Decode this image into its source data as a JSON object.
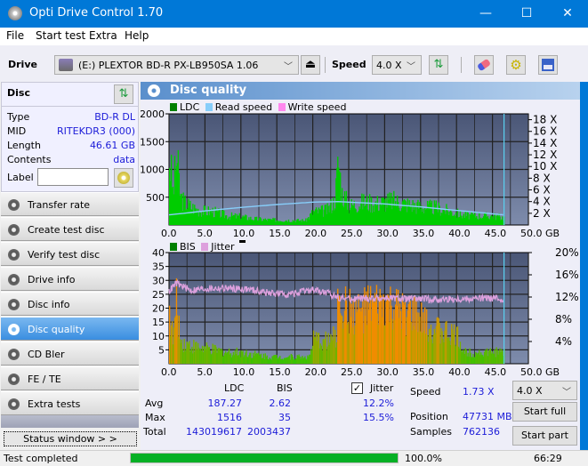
{
  "window": {
    "title": "Opti Drive Control 1.70",
    "minimize": "—",
    "maximize": "☐",
    "close": "✕"
  },
  "menu": [
    "File",
    "Start test",
    "Extra",
    "Help"
  ],
  "toolbar": {
    "drive_label": "Drive",
    "drive_value": "(E:)  PLEXTOR BD-R  PX-LB950SA 1.06",
    "speed_label": "Speed",
    "speed_value": "4.0 X"
  },
  "disc": {
    "header": "Disc",
    "rows": [
      {
        "label": "Type",
        "value": "BD-R DL"
      },
      {
        "label": "MID",
        "value": "RITEKDR3 (000)"
      },
      {
        "label": "Length",
        "value": "46.61 GB"
      },
      {
        "label": "Contents",
        "value": "data"
      }
    ],
    "label_field_label": "Label",
    "label_field_value": ""
  },
  "nav": [
    {
      "label": "Transfer rate",
      "active": false
    },
    {
      "label": "Create test disc",
      "active": false
    },
    {
      "label": "Verify test disc",
      "active": false
    },
    {
      "label": "Drive info",
      "active": false
    },
    {
      "label": "Disc info",
      "active": false
    },
    {
      "label": "Disc quality",
      "active": true
    },
    {
      "label": "CD Bler",
      "active": false
    },
    {
      "label": "FE / TE",
      "active": false
    },
    {
      "label": "Extra tests",
      "active": false
    }
  ],
  "status_window_label": "Status window > >",
  "panel_title": "Disc quality",
  "chart_data": [
    {
      "type": "bar",
      "title": "LDC",
      "legend": [
        "LDC",
        "Read speed",
        "Write speed"
      ],
      "legend_colors": {
        "LDC": "#008000",
        "Read speed": "#87cefa",
        "Write speed": "#ff88ee"
      },
      "xlabel": "GB",
      "x_ticks": [
        "0.0",
        "5.0",
        "10.0",
        "15.0",
        "20.0",
        "25.0",
        "30.0",
        "35.0",
        "40.0",
        "45.0",
        "50.0 GB"
      ],
      "y_ticks": [
        "2000",
        "1500",
        "1000",
        "500"
      ],
      "y2_ticks": [
        "18 X",
        "16 X",
        "14 X",
        "12 X",
        "10 X",
        "8 X",
        "6 X",
        "4 X",
        "2 X"
      ],
      "xlim": [
        0,
        50
      ],
      "ylim": [
        0,
        2000
      ],
      "y2lim": [
        0,
        19
      ],
      "series": [
        {
          "name": "LDC",
          "x": [
            0,
            0.5,
            1,
            1.5,
            2,
            3,
            4,
            5,
            6,
            8,
            10,
            12,
            14,
            16,
            18,
            19,
            20,
            21,
            22,
            23,
            23.5,
            24,
            25,
            27,
            29,
            31,
            33,
            35,
            37,
            39,
            41,
            43,
            45,
            46.6
          ],
          "values": [
            1470,
            700,
            1516,
            620,
            500,
            400,
            330,
            300,
            300,
            200,
            180,
            130,
            110,
            110,
            100,
            100,
            290,
            300,
            330,
            540,
            1400,
            700,
            420,
            500,
            480,
            530,
            460,
            400,
            380,
            300,
            210,
            200,
            200,
            160
          ]
        },
        {
          "name": "Read speed",
          "x": [
            0,
            5,
            10,
            15,
            20,
            23.4,
            25,
            30,
            35,
            40,
            46.6
          ],
          "values": [
            1.73,
            2.4,
            3.0,
            3.5,
            3.9,
            4.0,
            3.9,
            3.6,
            3.1,
            2.5,
            1.73
          ]
        }
      ],
      "end_marker_gb": 46.61
    },
    {
      "type": "bar",
      "title": "BIS",
      "legend": [
        "BIS",
        "Jitter"
      ],
      "legend_colors": {
        "BIS": "#008000",
        "Jitter": "#dda0dd"
      },
      "xlabel": "GB",
      "x_ticks": [
        "0.0",
        "5.0",
        "10.0",
        "15.0",
        "20.0",
        "25.0",
        "30.0",
        "35.0",
        "40.0",
        "45.0",
        "50.0 GB"
      ],
      "y_ticks": [
        "40",
        "35",
        "30",
        "25",
        "20",
        "15",
        "10",
        "5"
      ],
      "y2_ticks": [
        "20%",
        "16%",
        "12%",
        "8%",
        "4%"
      ],
      "xlim": [
        0,
        50
      ],
      "ylim": [
        0,
        40
      ],
      "y2lim": [
        0,
        20
      ],
      "series": [
        {
          "name": "BIS",
          "x": [
            0,
            0.5,
            1,
            1.5,
            2,
            4,
            6,
            8,
            10,
            12,
            14,
            16,
            18,
            19.5,
            20,
            22,
            23.3,
            23.5,
            24,
            26,
            28,
            30,
            32,
            34,
            36,
            38,
            40,
            41,
            43,
            45,
            46.6
          ],
          "values": [
            23,
            10,
            27,
            10,
            9,
            7,
            6,
            5,
            5,
            4,
            3,
            3,
            3,
            3,
            10,
            10,
            12,
            35,
            24,
            22,
            24,
            25,
            22,
            21,
            16,
            14,
            12,
            5,
            5,
            5,
            5
          ]
        },
        {
          "name": "Jitter",
          "x": [
            0,
            1,
            3,
            5,
            8,
            11,
            14,
            17,
            20,
            22,
            23.5,
            25,
            30,
            35,
            40,
            45,
            46.6
          ],
          "values": [
            13.0,
            14.5,
            13.2,
            13.5,
            13.6,
            13.4,
            12.7,
            12.5,
            13.3,
            12.7,
            12.0,
            11.7,
            11.8,
            11.6,
            11.6,
            11.8,
            11.5
          ]
        }
      ],
      "end_marker_gb": 46.61
    }
  ],
  "stats": {
    "col_ldc": "LDC",
    "col_bis": "BIS",
    "rows": [
      {
        "label": "Avg",
        "ldc": "187.27",
        "bis": "2.62",
        "jitter": "12.2%"
      },
      {
        "label": "Max",
        "ldc": "1516",
        "bis": "35",
        "jitter": "15.5%"
      },
      {
        "label": "Total",
        "ldc": "143019617",
        "bis": "2003437"
      }
    ],
    "jitter_label": "Jitter",
    "jitter_checked": true,
    "speed_label": "Speed",
    "speed_value": "1.73 X",
    "position_label": "Position",
    "position_value": "47731 MB",
    "samples_label": "Samples",
    "samples_value": "762136",
    "speed_select": "4.0 X",
    "start_full": "Start full",
    "start_part": "Start part"
  },
  "statusbar": {
    "text": "Test completed",
    "progress_pct": 100,
    "progress_label": "100.0%",
    "time": "66:29"
  }
}
